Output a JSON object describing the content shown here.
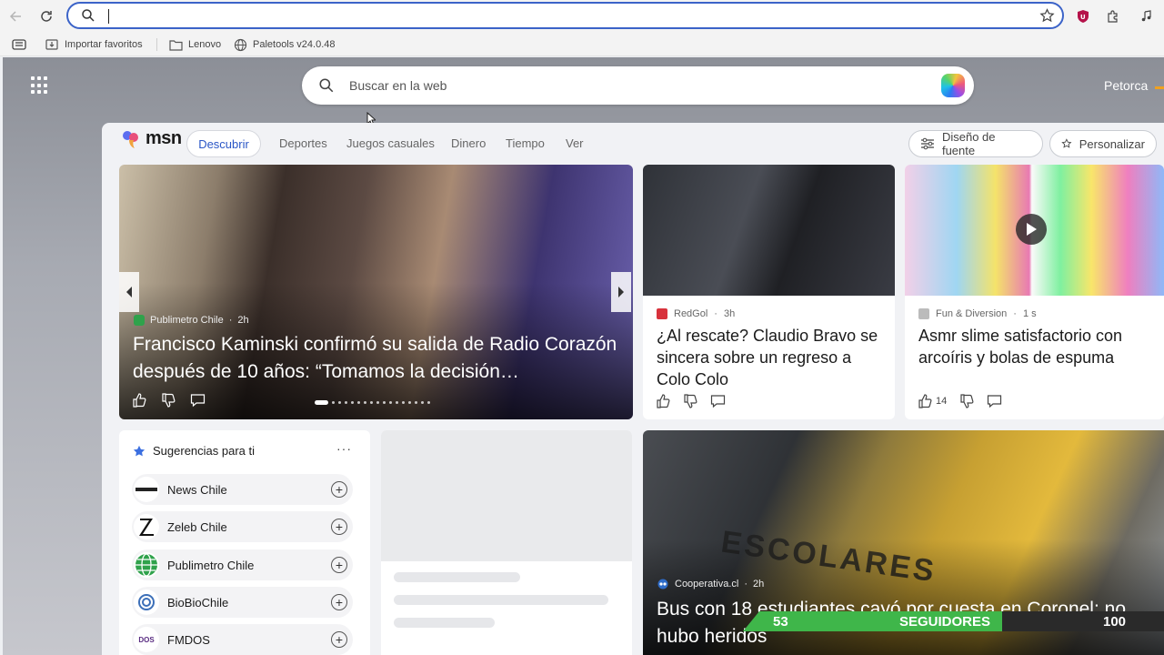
{
  "browser": {
    "address_value": "",
    "bookmarks": [
      "Importar favoritos",
      "Lenovo",
      "Paletools v24.0.48"
    ]
  },
  "newtab": {
    "search_placeholder": "Buscar en la web",
    "profile_name": "Petorca"
  },
  "msn": {
    "logo_text": "msn",
    "tabs": [
      "Descubrir",
      "Deportes",
      "Juegos casuales",
      "Dinero",
      "Tiempo",
      "Ver"
    ],
    "font_button": "Diseño de fuente",
    "personalize_button": "Personalizar"
  },
  "hero": {
    "source": "Publimetro Chile",
    "time": "2h",
    "title": "Francisco Kaminski confirmó su salida de Radio Corazón después de 10 años: “Tomamos la decisión…",
    "carousel_active": 1,
    "carousel_count": 17
  },
  "cards": [
    {
      "source": "RedGol",
      "time": "3h",
      "title": "¿Al rescate? Claudio Bravo se sincera sobre un regreso a Colo Colo",
      "likes": "",
      "accent": "#d8323c"
    },
    {
      "source": "Fun & Diversion",
      "time": "1 s",
      "title": "Asmr slime satisfactorio con arcoíris y bolas de espuma",
      "likes": "14",
      "accent": "#888888"
    }
  ],
  "suggestions": {
    "title": "Sugerencias para ti",
    "more": "···",
    "items": [
      "News Chile",
      "Zeleb Chile",
      "Publimetro Chile",
      "BioBioChile",
      "FMDOS"
    ],
    "icon_text": {
      "fmdos": "DOS"
    }
  },
  "big_story": {
    "source": "Cooperativa.cl",
    "time": "2h",
    "title": "Bus con 18 estudiantes cayó por cuesta en Coronel: no hubo heridos",
    "sign_text": "ESCOLARES"
  },
  "overlay": {
    "current": "53",
    "label": "SEGUIDORES",
    "goal": "100"
  },
  "colors": {
    "accent": "#2a56c6",
    "address_border": "#3b63c8",
    "overlay_green": "#3fb64a"
  }
}
